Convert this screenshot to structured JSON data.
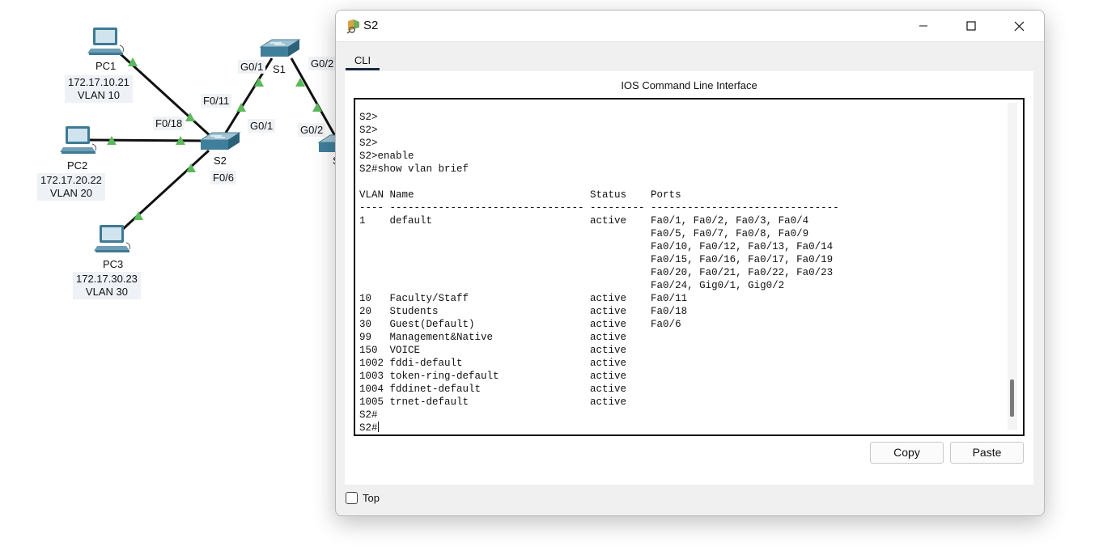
{
  "topology": {
    "devices": {
      "s1": {
        "label": "S1"
      },
      "s2": {
        "label": "S2"
      },
      "s3": {
        "label": "S"
      },
      "pc1": {
        "label": "PC1",
        "ip": "172.17.10.21",
        "vlan": "VLAN 10"
      },
      "pc2": {
        "label": "PC2",
        "ip": "172.17.20.22",
        "vlan": "VLAN 20"
      },
      "pc3": {
        "label": "PC3",
        "ip": "172.17.30.23",
        "vlan": "VLAN 30"
      }
    },
    "ports": {
      "s2_f011": "F0/11",
      "s2_f018": "F0/18",
      "s2_f06": "F0/6",
      "s2_g01": "G0/1",
      "s1_g01": "G0/1",
      "s1_g02": "G0/2",
      "s3_g02": "G0/2"
    },
    "link_color": "#111111",
    "link_light_color": "#5cb85c"
  },
  "window": {
    "title": "S2",
    "tabs": [
      {
        "label": "CLI",
        "active": true
      }
    ],
    "header": "IOS Command Line Interface",
    "terminal_lines": [
      "S2>",
      "S2>",
      "S2>",
      "S2>enable",
      "S2#show vlan brief",
      "",
      "VLAN Name                             Status    Ports",
      "---- -------------------------------- --------- -------------------------------",
      "1    default                          active    Fa0/1, Fa0/2, Fa0/3, Fa0/4",
      "                                                Fa0/5, Fa0/7, Fa0/8, Fa0/9",
      "                                                Fa0/10, Fa0/12, Fa0/13, Fa0/14",
      "                                                Fa0/15, Fa0/16, Fa0/17, Fa0/19",
      "                                                Fa0/20, Fa0/21, Fa0/22, Fa0/23",
      "                                                Fa0/24, Gig0/1, Gig0/2",
      "10   Faculty/Staff                    active    Fa0/11",
      "20   Students                         active    Fa0/18",
      "30   Guest(Default)                   active    Fa0/6",
      "99   Management&Native                active",
      "150  VOICE                            active",
      "1002 fddi-default                     active",
      "1003 token-ring-default               active",
      "1004 fddinet-default                  active",
      "1005 trnet-default                    active",
      "S2#"
    ],
    "prompt": "S2#",
    "copy_label": "Copy",
    "paste_label": "Paste",
    "top_label": "Top",
    "top_checked": false
  }
}
